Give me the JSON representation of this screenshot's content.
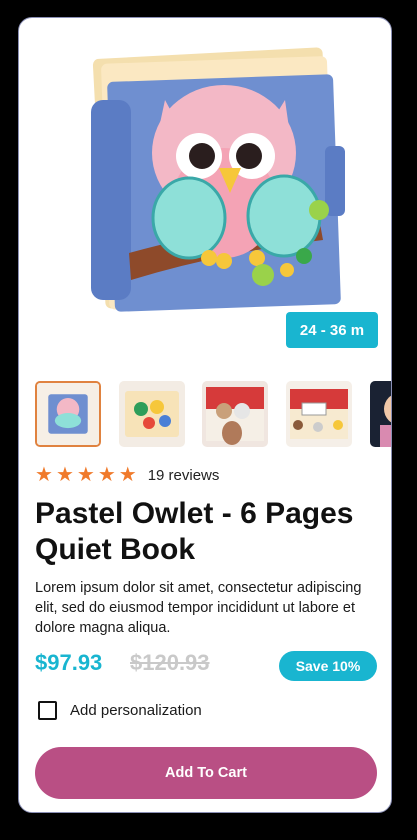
{
  "product": {
    "age_range": "24 - 36 m",
    "rating_stars": 5,
    "reviews": "19 reviews",
    "title": "Pastel Owlet - 6 Pages Quiet Book",
    "description": "Lorem ipsum dolor sit amet, consectetur adipiscing elit, sed do eiusmod tempor incididunt ut labore et dolore magna aliqua.",
    "price": "$97.93",
    "old_price": "$120.93",
    "save_label": "Save 10%",
    "personalization_label": "Add personalization",
    "personalization_checked": false,
    "add_to_cart_label": "Add To Cart"
  },
  "colors": {
    "accent": "#19b5d0",
    "button": "#b94f84",
    "stars": "#f07a2b",
    "selected_thumb_border": "#e0823f"
  }
}
